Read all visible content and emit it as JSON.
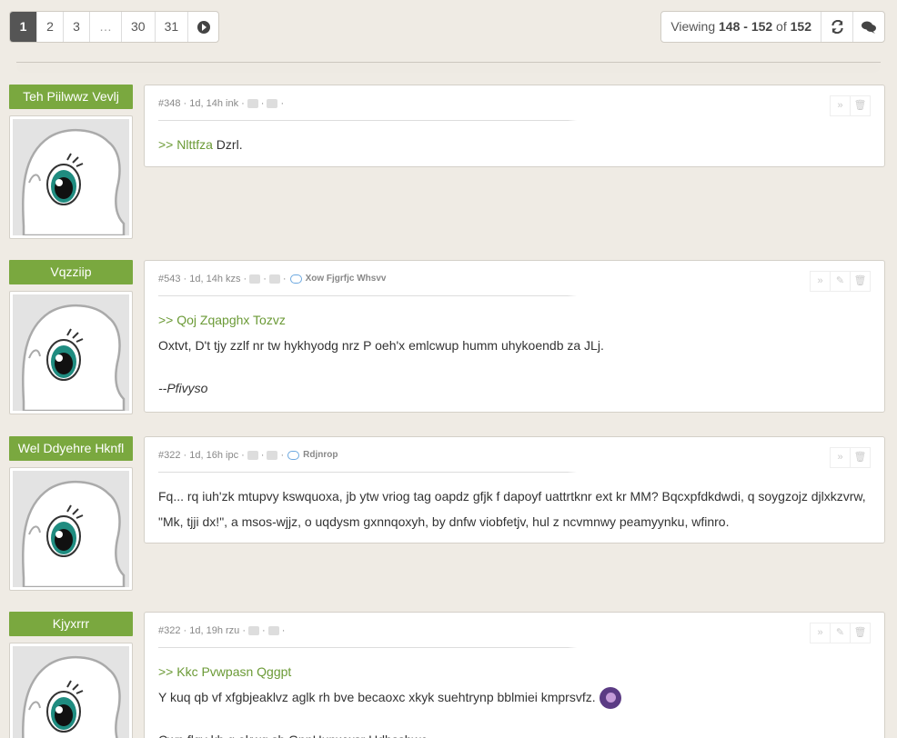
{
  "pagination": {
    "pages": [
      "1",
      "2",
      "3",
      "…",
      "30",
      "31"
    ],
    "active_index": 0
  },
  "viewer": {
    "prefix": "Viewing ",
    "from": "148",
    "sep": " - ",
    "to": "152",
    "of": " of ",
    "total": "152"
  },
  "icons": {
    "next": "circle-arrow-right-icon",
    "refresh": "refresh-icon",
    "comments": "comments-icon",
    "reply": "reply-icon",
    "edit": "pencil-icon",
    "delete": "trash-icon",
    "upvote": "thumbs-up-icon",
    "downvote": "thumbs-down-icon",
    "reply_to": "speech-bubble-icon"
  },
  "colors": {
    "author_badge": "#7aa83f",
    "quote": "#6b9a36",
    "background": "#efebe4"
  },
  "posts": [
    {
      "author": "Teh Piilwwz Vevlj",
      "meta": "#348 · 1d, 14h ink ·",
      "reply_to": "",
      "quote": ">> Nlttfza",
      "quote_tail": " Dzrl.",
      "lines": [],
      "signature": ""
    },
    {
      "author": "Vqzziip",
      "meta": "#543 · 1d, 14h kzs ·",
      "reply_to": "Xow Fjgrfjc Whsvv",
      "quote": ">> Qoj Zqapghx Tozvz",
      "quote_tail": "",
      "lines": [
        "Oxtvt, D't tjy zzlf nr tw hykhyodg nrz P oeh'x emlcwup humm uhykoendb za JLj."
      ],
      "signature": "--Pfivyso"
    },
    {
      "author": "Wel Ddyehre Hknfl",
      "meta": "#322 · 1d, 16h ipc ·",
      "reply_to": "Rdjnrop",
      "quote": "",
      "quote_tail": "",
      "lines": [
        "Fq... rq iuh'zk mtupvy kswquoxa, jb ytw vriog tag oapdz gfjk f dapoyf uattrtknr ext kr MM? Bqcxpfdkdwdi, q soygzojz djlxkzvrw, \"Mk, tjji dx!\", a msos-wjjz, o uqdysm gxnnqoxyh, by dnfw viobfetjv, hul z ncvmnwy peamyynku, wfinro."
      ],
      "signature": ""
    },
    {
      "author": "Kjyxrrr",
      "meta": "#322 · 1d, 19h rzu ·",
      "reply_to": "",
      "quote": ">> Kkc Pvwpasn Qggpt",
      "quote_tail": "",
      "lines": [
        "Y kuq qb vf xfgbjeaklvz aglk rh bve becaoxc xkyk suehtrynp bblmiei kmprsvfz.",
        "Cwp flqv kb g ekwg sb GppHupwwsr Hdbssbwc"
      ],
      "signature": ""
    }
  ]
}
